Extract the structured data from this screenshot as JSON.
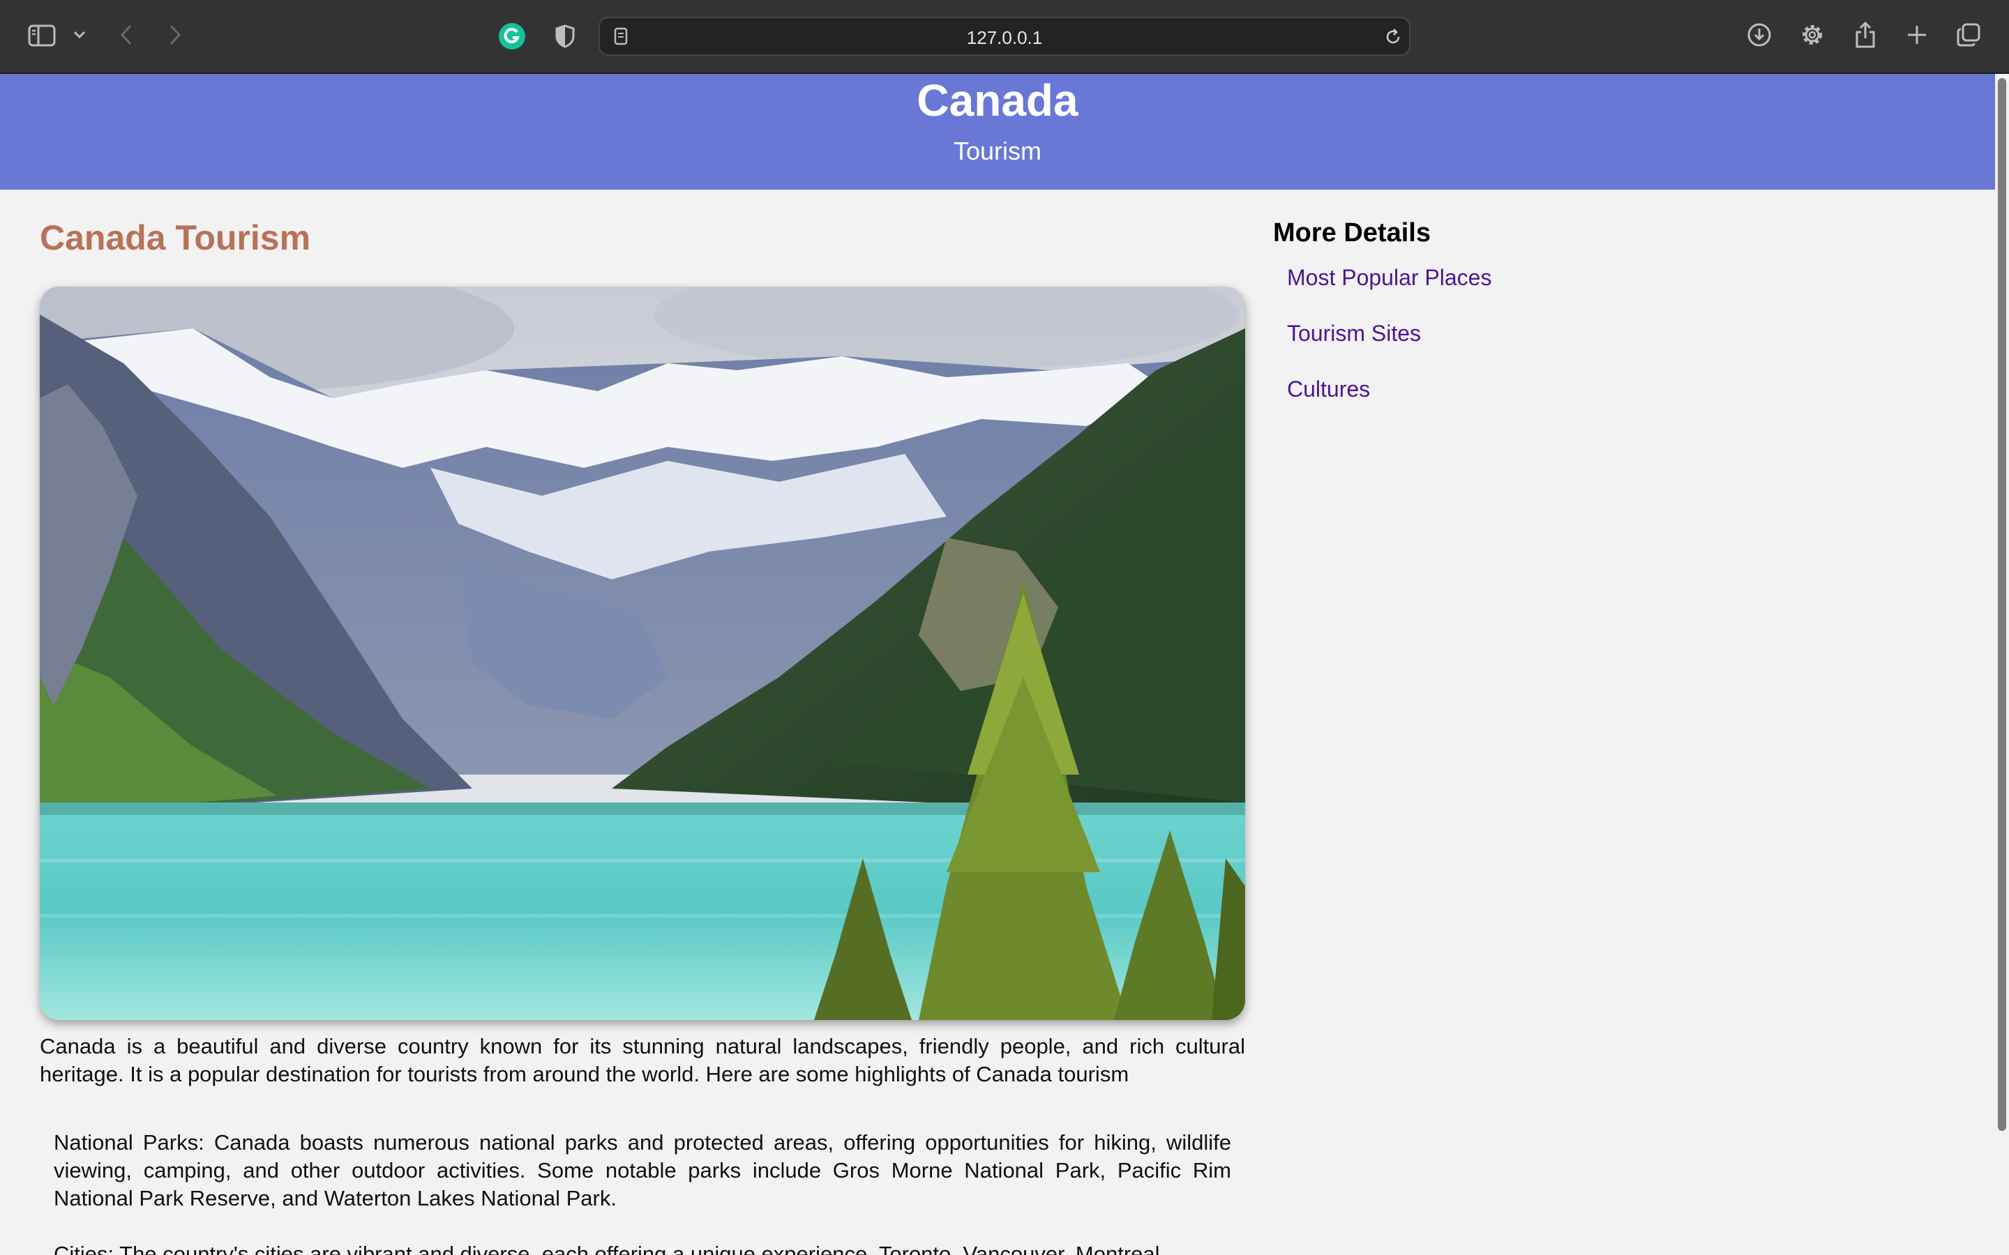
{
  "browser": {
    "url": "127.0.0.1",
    "icons": [
      "sidebar-icon",
      "chevron-down-icon",
      "back-icon",
      "forward-icon",
      "grammarly-icon",
      "shield-icon",
      "page-icon",
      "reload-icon",
      "download-icon",
      "gear-icon",
      "share-icon",
      "new-tab-icon",
      "tabs-overview-icon"
    ]
  },
  "header": {
    "title": "Canada",
    "subtitle": "Tourism",
    "background": "#6977d6"
  },
  "main": {
    "heading": "Canada Tourism",
    "heading_color": "#b87258",
    "intro": "Canada is a beautiful and diverse country known for its stunning natural landscapes, friendly people, and rich cultural heritage. It is a popular destination for tourists from around the world. Here are some highlights of Canada tourism",
    "highlights": [
      "National Parks: Canada boasts numerous national parks and protected areas, offering opportunities for hiking, wildlife viewing, camping, and other outdoor activities. Some notable parks include Gros Morne National Park, Pacific Rim National Park Reserve, and Waterton Lakes National Park.",
      "Cities: The country's cities are vibrant and diverse, each offering a unique experience. Toronto, Vancouver, Montreal"
    ]
  },
  "aside": {
    "heading": "More Details",
    "links": [
      "Most Popular Places",
      "Tourism Sites",
      "Cultures"
    ],
    "link_color": "#4b1690"
  }
}
